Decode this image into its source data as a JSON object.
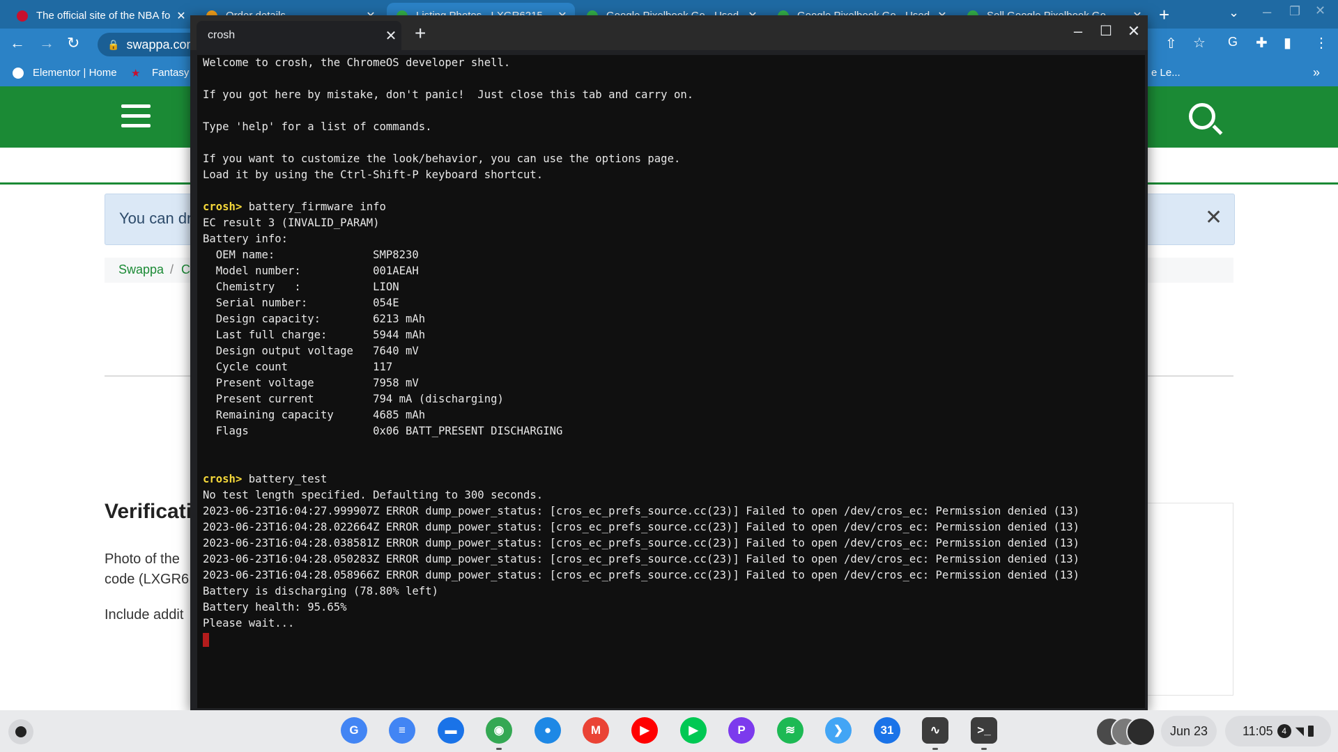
{
  "browser": {
    "tabs": [
      {
        "title": "The official site of the NBA fo",
        "color": "#c8102e"
      },
      {
        "title": "Order details",
        "color": "#f7a21b"
      },
      {
        "title": "Listing Photos - LXGR6215",
        "color": "#35b34a"
      },
      {
        "title": "Google Pixelbook Go - Used",
        "color": "#35b34a"
      },
      {
        "title": "Google Pixelbook Go - Used",
        "color": "#35b34a"
      },
      {
        "title": "Sell Google Pixelbook Go",
        "color": "#35b34a"
      }
    ],
    "url": "swappa.com",
    "bookmarks": [
      {
        "label": "Elementor | Home"
      },
      {
        "label": "Fantasy"
      },
      {
        "label": "e Le..."
      }
    ]
  },
  "page": {
    "alert_text": "You can dra",
    "breadcrumb_home": "Swappa",
    "breadcrumb_sep": "/",
    "breadcrumb_next": "C",
    "section_title": "Verificati",
    "para1_line1": "Photo of the",
    "para1_line2": "code (LXGR6",
    "para2": "Include addit"
  },
  "crosh": {
    "tab_label": "crosh",
    "close_glyph": "✕",
    "new_tab_glyph": "+",
    "lines": [
      {
        "t": "Welcome to crosh, the ChromeOS developer shell."
      },
      {
        "t": ""
      },
      {
        "t": "If you got here by mistake, don't panic!  Just close this tab and carry on."
      },
      {
        "t": ""
      },
      {
        "t": "Type 'help' for a list of commands."
      },
      {
        "t": ""
      },
      {
        "t": "If you want to customize the look/behavior, you can use the options page."
      },
      {
        "t": "Load it by using the Ctrl-Shift-P keyboard shortcut."
      },
      {
        "t": ""
      },
      {
        "prompt": "crosh>",
        "t": " battery_firmware info"
      },
      {
        "t": "EC result 3 (INVALID_PARAM)"
      },
      {
        "t": "Battery info:"
      },
      {
        "t": "  OEM name:               SMP8230"
      },
      {
        "t": "  Model number:           001AEAH"
      },
      {
        "t": "  Chemistry   :           LION"
      },
      {
        "t": "  Serial number:          054E"
      },
      {
        "t": "  Design capacity:        6213 mAh"
      },
      {
        "t": "  Last full charge:       5944 mAh"
      },
      {
        "t": "  Design output voltage   7640 mV"
      },
      {
        "t": "  Cycle count             117"
      },
      {
        "t": "  Present voltage         7958 mV"
      },
      {
        "t": "  Present current         794 mA (discharging)"
      },
      {
        "t": "  Remaining capacity      4685 mAh"
      },
      {
        "t": "  Flags                   0x06 BATT_PRESENT DISCHARGING"
      },
      {
        "t": ""
      },
      {
        "t": ""
      },
      {
        "prompt": "crosh>",
        "t": " battery_test"
      },
      {
        "t": "No test length specified. Defaulting to 300 seconds."
      },
      {
        "t": "2023-06-23T16:04:27.999907Z ERROR dump_power_status: [cros_ec_prefs_source.cc(23)] Failed to open /dev/cros_ec: Permission denied (13)"
      },
      {
        "t": "2023-06-23T16:04:28.022664Z ERROR dump_power_status: [cros_ec_prefs_source.cc(23)] Failed to open /dev/cros_ec: Permission denied (13)"
      },
      {
        "t": "2023-06-23T16:04:28.038581Z ERROR dump_power_status: [cros_ec_prefs_source.cc(23)] Failed to open /dev/cros_ec: Permission denied (13)"
      },
      {
        "t": "2023-06-23T16:04:28.050283Z ERROR dump_power_status: [cros_ec_prefs_source.cc(23)] Failed to open /dev/cros_ec: Permission denied (13)"
      },
      {
        "t": "2023-06-23T16:04:28.058966Z ERROR dump_power_status: [cros_ec_prefs_source.cc(23)] Failed to open /dev/cros_ec: Permission denied (13)"
      },
      {
        "t": "Battery is discharging (78.80% left)"
      },
      {
        "t": "Battery health: 95.65%"
      },
      {
        "t": "Please wait..."
      }
    ]
  },
  "shelf": {
    "apps": [
      {
        "name": "google-translate-icon",
        "glyph": "G",
        "color": "#4285f4"
      },
      {
        "name": "google-docs-icon",
        "glyph": "≡",
        "color": "#4285f4"
      },
      {
        "name": "files-icon",
        "glyph": "▬",
        "color": "#1a73e8"
      },
      {
        "name": "chrome-icon",
        "glyph": "◉",
        "color": "#34a853"
      },
      {
        "name": "google-chat-icon",
        "glyph": "●",
        "color": "#1e88e5"
      },
      {
        "name": "gmail-icon",
        "glyph": "M",
        "color": "#ea4335"
      },
      {
        "name": "youtube-icon",
        "glyph": "▶",
        "color": "#ff0000"
      },
      {
        "name": "play-store-icon",
        "glyph": "▶",
        "color": "#00c853"
      },
      {
        "name": "picsart-icon",
        "glyph": "P",
        "color": "#7c3aed"
      },
      {
        "name": "spotify-icon",
        "glyph": "≋",
        "color": "#1db954"
      },
      {
        "name": "flutter-icon",
        "glyph": "❯",
        "color": "#42a5f5"
      },
      {
        "name": "google-calendar-icon",
        "glyph": "31",
        "color": "#1a73e8"
      },
      {
        "name": "activity-graph-icon",
        "glyph": "∿",
        "color": "#3c3c3c"
      },
      {
        "name": "terminal-icon",
        "glyph": ">_",
        "color": "#3c3c3c"
      }
    ],
    "date": "Jun 23",
    "time": "11:05",
    "notification_count": "4"
  }
}
